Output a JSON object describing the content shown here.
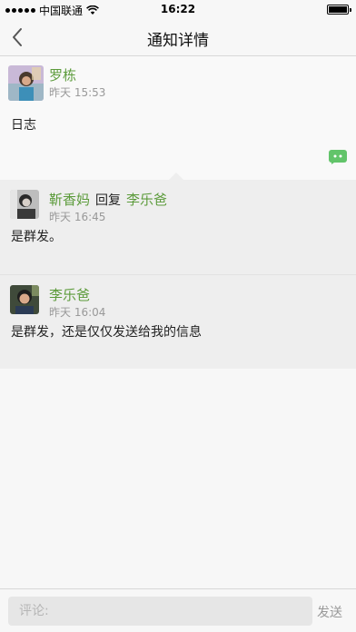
{
  "status_bar": {
    "carrier": "中国联通",
    "time": "16:22",
    "icons": [
      "signal-icon",
      "wifi-icon",
      "battery-icon"
    ]
  },
  "nav": {
    "title": "通知详情",
    "back_icon": "chevron-left-icon"
  },
  "post": {
    "author": "罗栋",
    "time": "昨天 15:53",
    "content": "日志",
    "comment_icon": "comment-bubble-icon"
  },
  "comments": [
    {
      "author": "靳香妈",
      "verb": "回复",
      "reply_to": "李乐爸",
      "time": "昨天 16:45",
      "text": "是群发。"
    },
    {
      "author": "李乐爸",
      "time": "昨天 16:04",
      "text": "是群发，还是仅仅发送给我的信息"
    }
  ],
  "input_bar": {
    "placeholder": "评论:",
    "send_label": "发送"
  },
  "colors": {
    "accent_green": "#5c9b3b",
    "comment_icon_green": "#62c46a",
    "background": "#f7f7f7",
    "comment_bg": "#eeeeee"
  }
}
